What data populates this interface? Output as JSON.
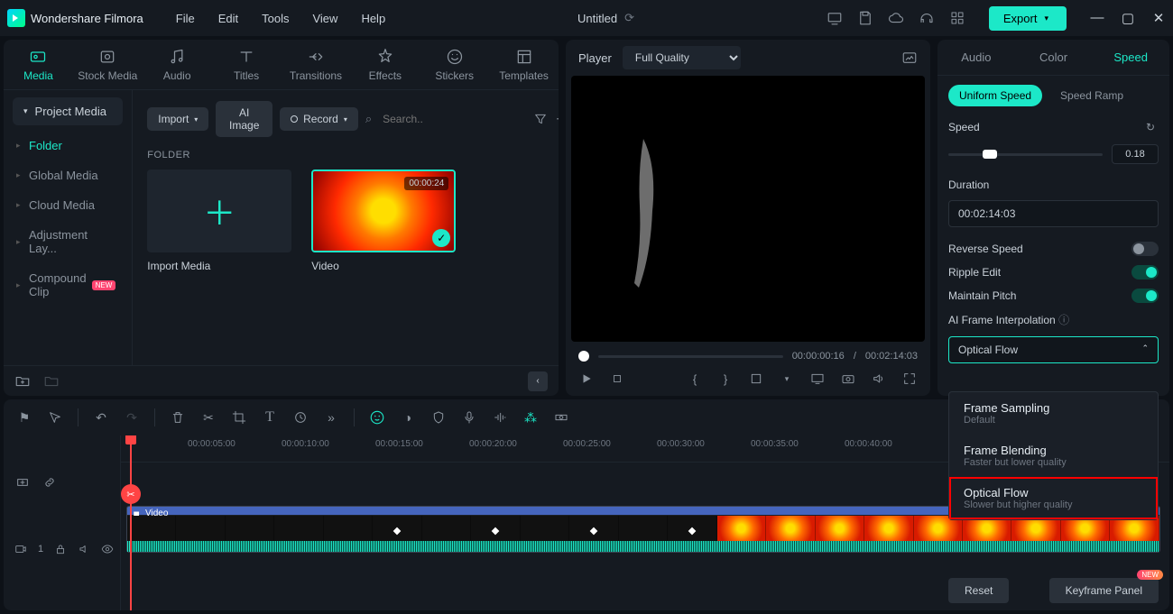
{
  "app_name": "Wondershare Filmora",
  "menu": [
    "File",
    "Edit",
    "Tools",
    "View",
    "Help"
  ],
  "doc_title": "Untitled",
  "export_label": "Export",
  "media_tabs": [
    {
      "id": "media",
      "label": "Media"
    },
    {
      "id": "stock",
      "label": "Stock Media"
    },
    {
      "id": "audio",
      "label": "Audio"
    },
    {
      "id": "titles",
      "label": "Titles"
    },
    {
      "id": "transitions",
      "label": "Transitions"
    },
    {
      "id": "effects",
      "label": "Effects"
    },
    {
      "id": "stickers",
      "label": "Stickers"
    },
    {
      "id": "templates",
      "label": "Templates"
    }
  ],
  "sidebar": {
    "project_media": "Project Media",
    "items": [
      "Folder",
      "Global Media",
      "Cloud Media",
      "Adjustment Lay...",
      "Compound Clip"
    ]
  },
  "mm": {
    "import": "Import",
    "ai_image": "AI Image",
    "record": "Record",
    "search_ph": "Search..",
    "folder_lbl": "FOLDER",
    "import_media": "Import Media",
    "clip_name": "Video",
    "clip_dur": "00:00:24"
  },
  "player": {
    "label": "Player",
    "quality": "Full Quality",
    "cur": "00:00:00:16",
    "sep": "/",
    "total": "00:02:14:03"
  },
  "right": {
    "tabs": [
      "Audio",
      "Color",
      "Speed"
    ],
    "speed_tabs": [
      "Uniform Speed",
      "Speed Ramp"
    ],
    "speed_lbl": "Speed",
    "speed_val": "0.18",
    "duration_lbl": "Duration",
    "duration_val": "00:02:14:03",
    "rev": "Reverse Speed",
    "ripple": "Ripple Edit",
    "pitch": "Maintain Pitch",
    "ai_lbl": "AI Frame Interpolation",
    "ai_sel": "Optical Flow",
    "dd": [
      {
        "t": "Frame Sampling",
        "s": "Default"
      },
      {
        "t": "Frame Blending",
        "s": "Faster but lower quality"
      },
      {
        "t": "Optical Flow",
        "s": "Slower but higher quality"
      }
    ],
    "reset": "Reset",
    "keyframe": "Keyframe Panel",
    "new": "NEW"
  },
  "timeline": {
    "ticks": [
      "00:00:05:00",
      "00:00:10:00",
      "00:00:15:00",
      "00:00:20:00",
      "00:00:25:00",
      "00:00:30:00",
      "00:00:35:00",
      "00:00:40:00"
    ],
    "track_label": "Video",
    "track_num": "1"
  }
}
